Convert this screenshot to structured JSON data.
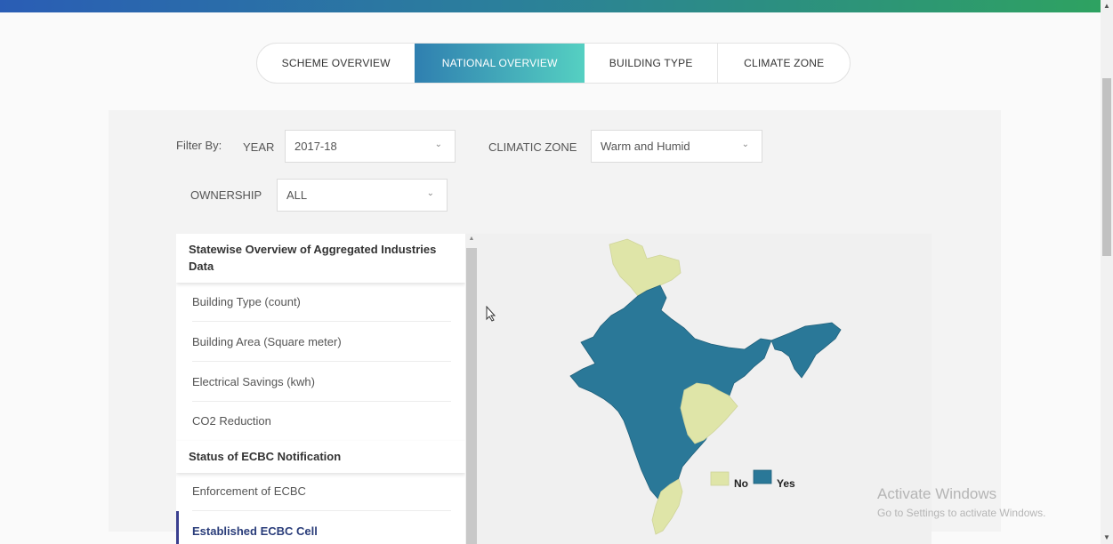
{
  "tabs": [
    {
      "label": "SCHEME OVERVIEW"
    },
    {
      "label": "NATIONAL OVERVIEW"
    },
    {
      "label": "BUILDING TYPE"
    },
    {
      "label": "CLIMATE ZONE"
    }
  ],
  "filters": {
    "filter_by_label": "Filter By:",
    "year_label": "YEAR",
    "year_value": "2017-18",
    "climatic_zone_label": "CLIMATIC ZONE",
    "climatic_zone_value": "Warm and Humid",
    "ownership_label": "OWNERSHIP",
    "ownership_value": "ALL"
  },
  "sidebar": {
    "section1_title": "Statewise Overview of Aggregated Industries Data",
    "section1_items": [
      {
        "label": "Building Type (count)"
      },
      {
        "label": "Building Area (Square meter)"
      },
      {
        "label": "Electrical Savings (kwh)"
      },
      {
        "label": "CO2 Reduction"
      }
    ],
    "section2_title": "Status of ECBC Notification",
    "section2_items": [
      {
        "label": "Enforcement of ECBC"
      },
      {
        "label": "Established ECBC Cell"
      }
    ]
  },
  "map": {
    "legend_no": "No",
    "legend_yes": "Yes",
    "color_no": "#dfe5a8",
    "color_yes": "#2a7898"
  },
  "watermark": {
    "line1": "Activate Windows",
    "line2": "Go to Settings to activate Windows."
  }
}
